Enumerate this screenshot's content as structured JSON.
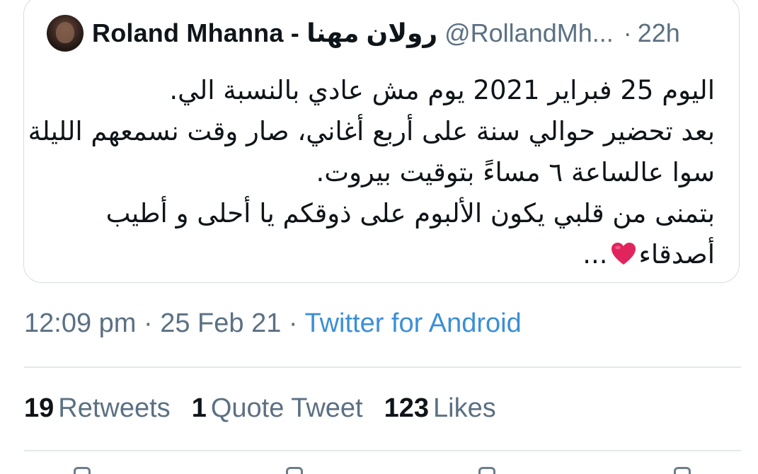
{
  "quoted_tweet": {
    "display_name": "Roland Mhanna - رولان مهنا",
    "handle": "@RollandMh...",
    "separator": "·",
    "time_ago": "22h",
    "text_lines": [
      "اليوم 25 فبراير 2021 يوم مش عادي بالنسبة الي.",
      "بعد تحضير حوالي سنة على أربع أغاني، صار وقت نسمعهم الليلة",
      "سوا عالساعة ٦ مساءً بتوقيت بيروت.",
      "بتمنى من قلبي يكون الألبوم على ذوقكم يا أحلى و أطيب",
      "أصدقاء"
    ],
    "ellipsis": "...",
    "heart_icon": "red-heart-emoji",
    "heart_color": "#e0245e"
  },
  "tweet_meta": {
    "time": "12:09 pm",
    "separator1": " · ",
    "date": "25 Feb 21",
    "separator2": " · ",
    "source": "Twitter for Android"
  },
  "stats": {
    "retweets_count": "19",
    "retweets_label": "Retweets",
    "quotes_count": "1",
    "quotes_label": "Quote Tweet",
    "likes_count": "123",
    "likes_label": "Likes"
  },
  "colors": {
    "text_primary": "#0f1419",
    "text_secondary": "#5b7083",
    "link": "#3b8fd6",
    "border": "#d7dde2"
  }
}
